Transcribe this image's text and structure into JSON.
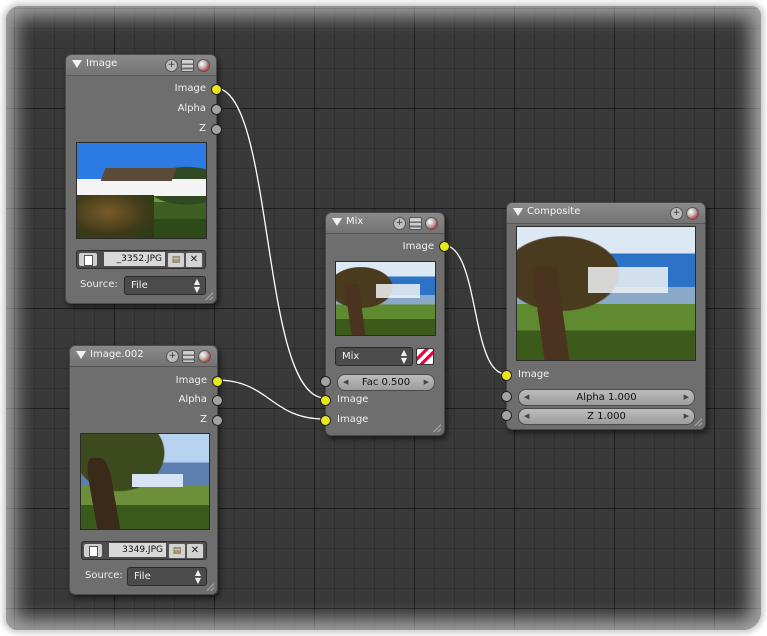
{
  "nodes": {
    "image1": {
      "title": "Image",
      "outputs": [
        "Image",
        "Alpha",
        "Z"
      ],
      "file_name": "_3352.JPG",
      "source_label": "Source:",
      "source_value": "File"
    },
    "image2": {
      "title": "Image.002",
      "outputs": [
        "Image",
        "Alpha",
        "Z"
      ],
      "file_name": "3349.JPG",
      "source_label": "Source:",
      "source_value": "File"
    },
    "mix": {
      "title": "Mix",
      "output": "Image",
      "blend_mode": "Mix",
      "fac": "Fac 0.500",
      "inputs": [
        "Image",
        "Image"
      ]
    },
    "composite": {
      "title": "Composite",
      "input": "Image",
      "alpha": "Alpha 1.000",
      "z": "Z 1.000"
    }
  },
  "socket_colors": {
    "image": "#e7e71c",
    "value": "#a3a3a3"
  },
  "icons": {
    "collapse": "triangle-down-icon",
    "add": "plus-circle-icon",
    "browse": "folder-icon",
    "clear": "x-icon",
    "render_preview": "sphere-icon",
    "layers": "bars-icon",
    "blend": "checker-blend-icon"
  }
}
